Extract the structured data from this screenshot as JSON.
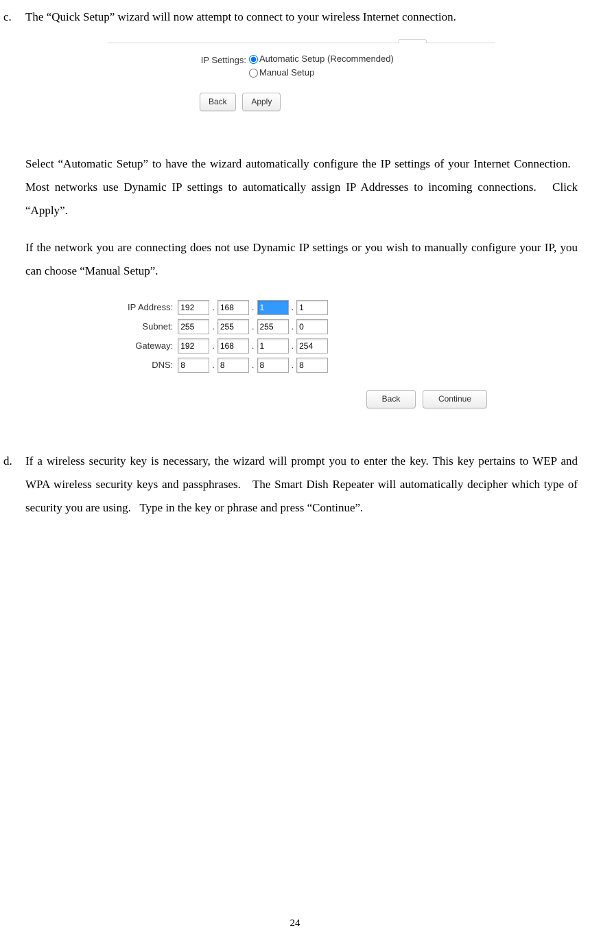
{
  "item_c": {
    "marker": "c.",
    "p1": "The “Quick Setup” wizard will now attempt to connect to your wireless Internet connection.",
    "p2": "Select “Automatic Setup” to have the wizard automatically configure the IP settings of your Internet Connection.   Most networks use Dynamic IP settings to automatically assign IP Addresses to incoming connections.   Click “Apply”.",
    "p3": "If the network you are connecting does not use Dynamic IP settings or you wish to manually configure your IP, you can choose “Manual Setup”."
  },
  "shot1": {
    "label": "IP Settings:",
    "opt_auto": "Automatic Setup (Recommended)",
    "opt_manual": "Manual Setup",
    "btn_back": "Back",
    "btn_apply": "Apply"
  },
  "shot2": {
    "lbl_ip": "IP Address:",
    "lbl_sub": "Subnet:",
    "lbl_gw": "Gateway:",
    "lbl_dns": "DNS:",
    "ip": [
      "192",
      "168",
      "1",
      "1"
    ],
    "sub": [
      "255",
      "255",
      "255",
      "0"
    ],
    "gw": [
      "192",
      "168",
      "1",
      "254"
    ],
    "dns": [
      "8",
      "8",
      "8",
      "8"
    ],
    "btn_back": "Back",
    "btn_continue": "Continue"
  },
  "item_d": {
    "marker": "d.",
    "p1": "If a wireless security key is necessary, the wizard will prompt you to enter the key. This key pertains to WEP and WPA wireless security keys and passphrases.   The Smart Dish Repeater will automatically decipher which type of security you are using.   Type in the key or phrase and press “Continue”."
  },
  "page_number": "24"
}
